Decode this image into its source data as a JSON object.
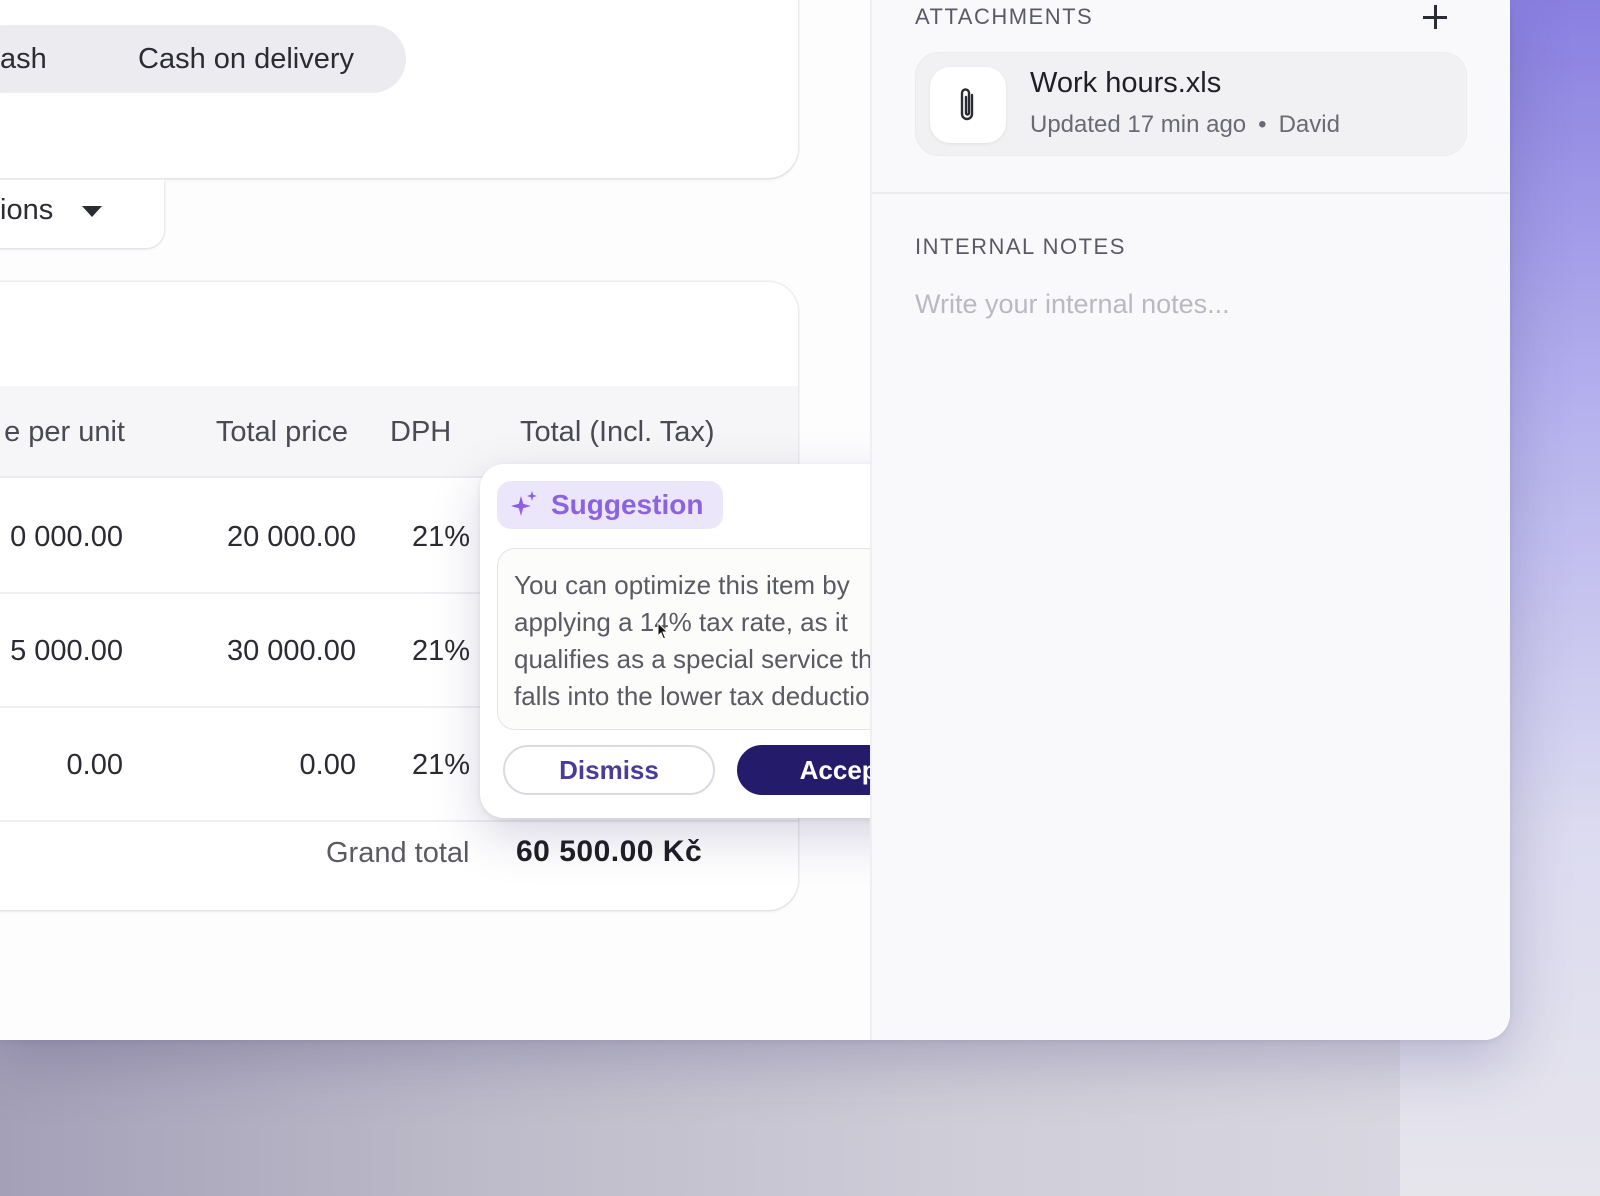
{
  "payment": {
    "options": [
      "ash",
      "Cash on delivery"
    ]
  },
  "dropdown": {
    "label": "ions",
    "icon": "caret-down-icon"
  },
  "items_table": {
    "columns": [
      "e per unit",
      "Total price",
      "DPH",
      "Total (Incl. Tax)"
    ],
    "rows": [
      {
        "price_per_unit": "0 000.00",
        "total_price": "20 000.00",
        "dph": "21%"
      },
      {
        "price_per_unit": "5 000.00",
        "total_price": "30 000.00",
        "dph": "21%"
      },
      {
        "price_per_unit": "0.00",
        "total_price": "0.00",
        "dph": "21%"
      }
    ],
    "grand_total_label": "Grand total",
    "grand_total_value": "60 500.00 Kč"
  },
  "sidebar": {
    "attachments": {
      "title": "ATTACHMENTS",
      "add_icon": "plus-icon",
      "file": {
        "icon": "paperclip-icon",
        "name": "Work hours.xls",
        "updated": "Updated 17 min ago",
        "separator": "•",
        "author": "David"
      }
    },
    "notes": {
      "title": "INTERNAL NOTES",
      "placeholder": "Write your internal notes..."
    }
  },
  "suggestion": {
    "badge": "Suggestion",
    "icon": "sparkle-icon",
    "text": "You can optimize this item by applying a 14% tax rate, as it qualifies as a special service that falls into the lower tax deduction.",
    "dismiss_label": "Dismiss",
    "accept_label": "Accept"
  },
  "colors": {
    "accent": "#8b63e0",
    "primary_button": "#241b6b",
    "badge_bg": "#ece6fb"
  }
}
